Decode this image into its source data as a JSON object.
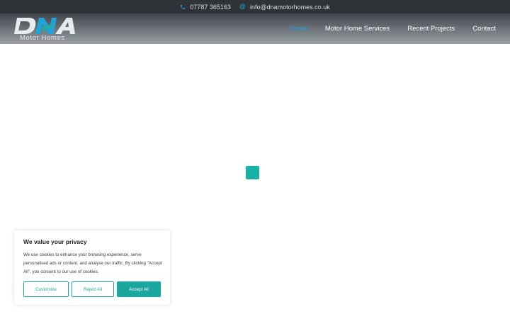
{
  "topbar": {
    "phone": "07787 365163",
    "email": "info@dnamotorhomes.co.uk",
    "phone_icon": "phone-icon",
    "email_icon": "at-icon"
  },
  "header": {
    "logo_text": "DNA",
    "logo_subtitle": "Motor Homes",
    "nav": [
      {
        "label": "Home",
        "active": true
      },
      {
        "label": "Motor Home Services",
        "active": false
      },
      {
        "label": "Recent Projects",
        "active": false
      },
      {
        "label": "Contact",
        "active": false
      }
    ]
  },
  "cookie_banner": {
    "title": "We value your privacy",
    "text": "We use cookies to enhance your browsing experience, serve personalised ads or content, and analyse our traffic. By clicking \"Accept All\", you consent to our use of cookies.",
    "customize_label": "Customize",
    "reject_label": "Reject All",
    "accept_label": "Accept All"
  },
  "colors": {
    "accent": "#1fa3d8",
    "teal": "#19a7a0",
    "topbar_bg": "#2f3338"
  }
}
